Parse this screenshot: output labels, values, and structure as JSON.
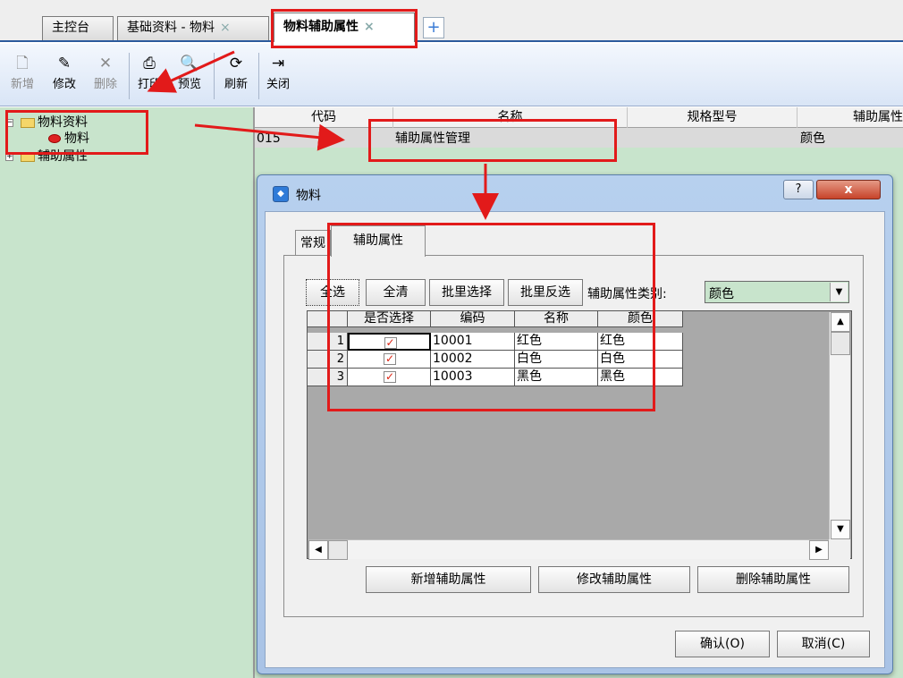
{
  "tabs": [
    {
      "label": "主控台",
      "closable": false,
      "active": false
    },
    {
      "label": "基础资料 - 物料",
      "closable": true,
      "active": false
    },
    {
      "label": "物料辅助属性",
      "closable": true,
      "active": true
    }
  ],
  "tab_close_glyph": "×",
  "tab_add_glyph": "+",
  "toolbar": [
    {
      "id": "new",
      "label": "新增",
      "icon": "new-document-icon",
      "glyph": "🗋",
      "enabled": false
    },
    {
      "id": "edit",
      "label": "修改",
      "icon": "edit-icon",
      "glyph": "✎",
      "enabled": true
    },
    {
      "id": "delete",
      "label": "删除",
      "icon": "delete-icon",
      "glyph": "✕",
      "enabled": false
    },
    {
      "id": "print",
      "label": "打印",
      "icon": "printer-icon",
      "glyph": "⎙",
      "enabled": true
    },
    {
      "id": "preview",
      "label": "预览",
      "icon": "preview-icon",
      "glyph": "🔍",
      "enabled": true
    },
    {
      "id": "refresh",
      "label": "刷新",
      "icon": "refresh-icon",
      "glyph": "⟳",
      "enabled": true
    },
    {
      "id": "close",
      "label": "关闭",
      "icon": "exit-door-icon",
      "glyph": "⇥",
      "enabled": true
    }
  ],
  "tree": [
    {
      "label": "物料资料",
      "expanded": true,
      "depth": 0
    },
    {
      "label": "物料",
      "expanded": false,
      "depth": 1
    },
    {
      "label": "辅助属性",
      "expanded": false,
      "depth": 0
    }
  ],
  "grid": {
    "columns": [
      "代码",
      "名称",
      "规格型号",
      "辅助属性"
    ],
    "row": {
      "code": "015",
      "name": "辅助属性管理",
      "spec": "",
      "attr": "颜色"
    }
  },
  "dialog": {
    "title": "物料",
    "help_glyph": "?",
    "close_glyph": "x",
    "tabs": [
      "常规",
      "辅助属性"
    ],
    "active_tab": "辅助属性",
    "buttons": {
      "select_all": "全选",
      "clear_all": "全清",
      "batch_select": "批里选择",
      "batch_invert": "批里反选"
    },
    "category_label": "辅助属性类别:",
    "category_value": "颜色",
    "table": {
      "headers": [
        "是否选择",
        "编码",
        "名称",
        "颜色"
      ],
      "rows": [
        {
          "num": "1",
          "selected": true,
          "code": "10001",
          "name": "红色",
          "color": "红色"
        },
        {
          "num": "2",
          "selected": true,
          "code": "10002",
          "name": "白色",
          "color": "白色"
        },
        {
          "num": "3",
          "selected": true,
          "code": "10003",
          "name": "黑色",
          "color": "黑色"
        }
      ],
      "check_glyph": "✓"
    },
    "action_buttons": [
      "新增辅助属性",
      "修改辅助属性",
      "删除辅助属性"
    ],
    "ok": "确认(O)",
    "cancel": "取消(C)"
  },
  "colors": {
    "annotation_red": "#e21a1a",
    "tree_background": "#c8e4cc",
    "accent_blue": "#2b5a9c"
  }
}
